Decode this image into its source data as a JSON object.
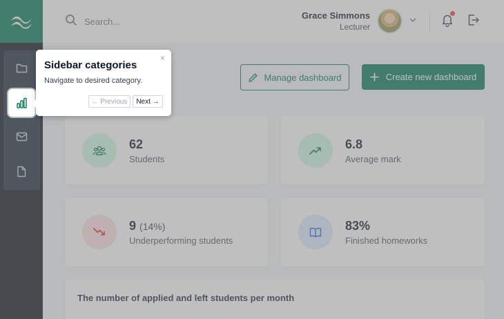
{
  "search": {
    "placeholder": "Search..."
  },
  "user": {
    "name": "Grace Simmons",
    "role": "Lecturer"
  },
  "toolbar": {
    "manage_label": "Manage dashboard",
    "create_label": "Create new dashboard"
  },
  "stats": [
    {
      "value": "62",
      "sub": "",
      "label": "Students",
      "icon": "users-icon",
      "color": "#047857"
    },
    {
      "value": "6.8",
      "sub": "",
      "label": "Average mark",
      "icon": "trending-up-icon",
      "color": "#047857"
    },
    {
      "value": "9",
      "sub": "(14%)",
      "label": "Underperforming students",
      "icon": "trending-down-icon",
      "color": "#dc2626"
    },
    {
      "value": "83%",
      "sub": "",
      "label": "Finished homeworks",
      "icon": "book-icon",
      "color": "#2563eb"
    }
  ],
  "chart": {
    "title": "The number of applied and left students per month"
  },
  "sidebar": {
    "items": [
      {
        "name": "folder-icon"
      },
      {
        "name": "bar-chart-icon"
      },
      {
        "name": "mail-icon"
      },
      {
        "name": "file-icon"
      }
    ]
  },
  "tour": {
    "title": "Sidebar categories",
    "description": "Navigate to desired category.",
    "close": "×",
    "prev_label": "← Previous",
    "next_label": "Next →"
  },
  "colors": {
    "brand": "#047857",
    "sidebar": "#0f1720",
    "danger": "#dc2626",
    "info": "#2563eb"
  }
}
